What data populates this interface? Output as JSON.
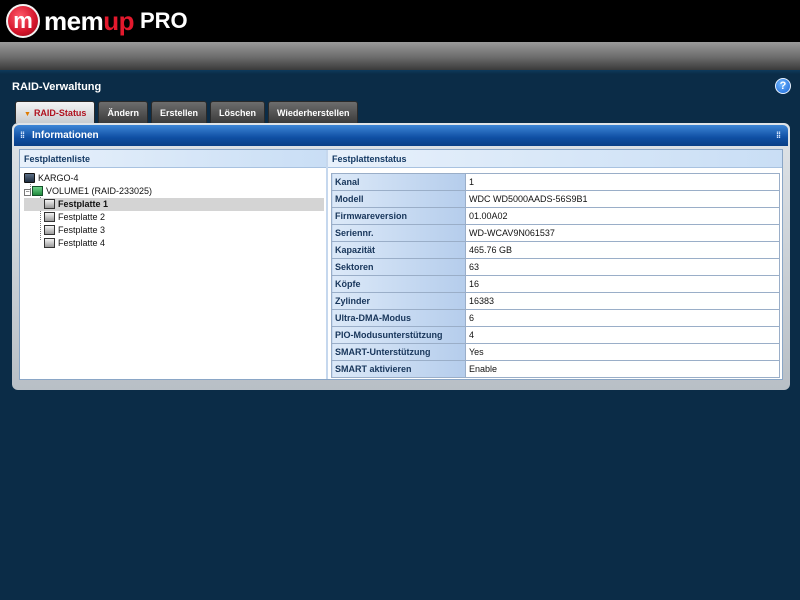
{
  "brand": {
    "badge": "m",
    "word_a": "mem",
    "word_b": "up",
    "pro": "PRO"
  },
  "page": {
    "title": "RAID-Verwaltung",
    "help": "?"
  },
  "tabs": [
    {
      "label": "RAID-Status",
      "active": true
    },
    {
      "label": "Ändern"
    },
    {
      "label": "Erstellen"
    },
    {
      "label": "Löschen"
    },
    {
      "label": "Wiederherstellen"
    }
  ],
  "panel": {
    "title": "Informationen",
    "grip": "⁞⁞"
  },
  "left": {
    "header": "Festplattenliste",
    "tree": {
      "root": "KARGO-4",
      "volume": "VOLUME1 (RAID-233025)",
      "disks": [
        "Festplatte 1",
        "Festplatte 2",
        "Festplatte 3",
        "Festplatte 4"
      ],
      "selected_index": 0
    }
  },
  "right": {
    "header": "Festplattenstatus",
    "rows": [
      {
        "label": "Kanal",
        "value": "1"
      },
      {
        "label": "Modell",
        "value": "WDC WD5000AADS-56S9B1"
      },
      {
        "label": "Firmwareversion",
        "value": "01.00A02"
      },
      {
        "label": "Seriennr.",
        "value": "WD-WCAV9N061537"
      },
      {
        "label": "Kapazität",
        "value": "465.76 GB"
      },
      {
        "label": "Sektoren",
        "value": "63"
      },
      {
        "label": "Köpfe",
        "value": "16"
      },
      {
        "label": "Zylinder",
        "value": "16383"
      },
      {
        "label": "Ultra-DMA-Modus",
        "value": "6"
      },
      {
        "label": "PIO-Modusunterstützung",
        "value": "4"
      },
      {
        "label": "SMART-Unterstützung",
        "value": "Yes"
      },
      {
        "label": "SMART aktivieren",
        "value": "Enable"
      }
    ]
  },
  "colors": {
    "background": "#0b2c47",
    "accent": "#e3192d",
    "header_blue": "#0f4fa3"
  }
}
